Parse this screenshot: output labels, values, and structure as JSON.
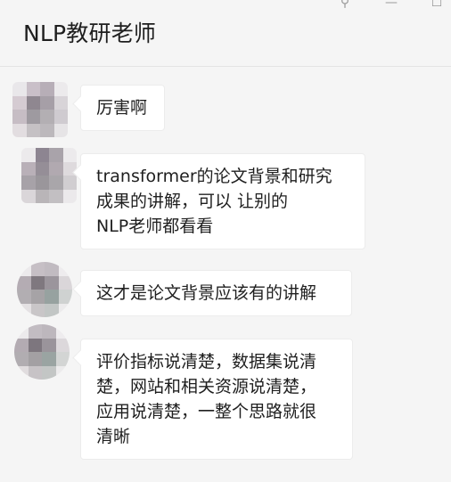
{
  "window": {
    "title": "NLP教研老师",
    "controls": [
      {
        "name": "pin-icon",
        "glyph": "⚲"
      },
      {
        "name": "minimize-icon",
        "glyph": "—"
      },
      {
        "name": "maximize-icon",
        "glyph": "☐"
      }
    ]
  },
  "messages": [
    {
      "lines": [
        "厉害啊"
      ]
    },
    {
      "lines": [
        "transformer的论文背景和研究",
        "成果的讲解，可以 让别的",
        "NLP老师都看看"
      ]
    },
    {
      "lines": [
        "这才是论文背景应该有的讲解"
      ]
    },
    {
      "lines": [
        "评价指标说清楚，数据集说清",
        "楚，网站和相关资源说清楚，",
        "应用说清楚，一整个思路就很",
        "清晰"
      ]
    }
  ]
}
